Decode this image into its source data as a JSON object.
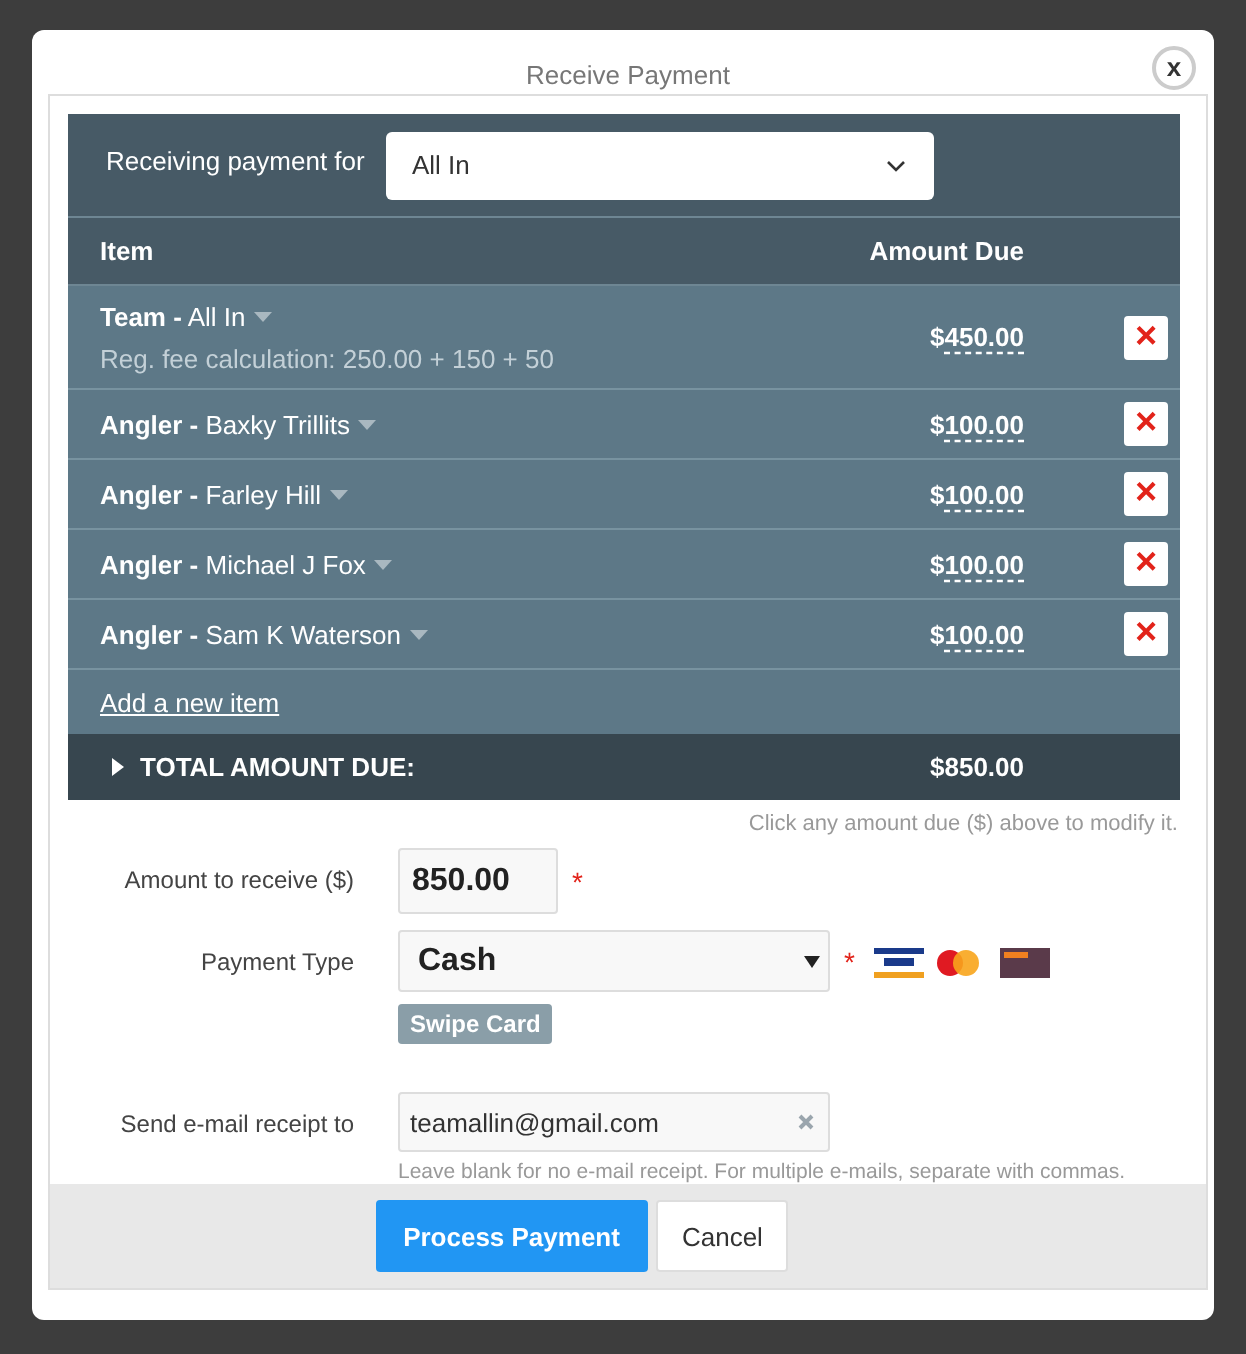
{
  "dialog": {
    "title": "Receive Payment",
    "close": "x"
  },
  "payer": {
    "label": "Receiving payment for",
    "value": "All In"
  },
  "table": {
    "columns": [
      "Item",
      "Amount Due"
    ],
    "rows": [
      {
        "category": "Team -",
        "name": "All In",
        "note": "Reg. fee calculation: 250.00 + 150 + 50",
        "currency": "$",
        "amount": "450.00",
        "remove": "×"
      },
      {
        "category": "Angler -",
        "name": "Baxky Trillits",
        "currency": "$",
        "amount": "100.00",
        "remove": "×"
      },
      {
        "category": "Angler -",
        "name": "Farley Hill",
        "currency": "$",
        "amount": "100.00",
        "remove": "×"
      },
      {
        "category": "Angler -",
        "name": "Michael J Fox",
        "currency": "$",
        "amount": "100.00",
        "remove": "×"
      },
      {
        "category": "Angler -",
        "name": "Sam K Waterson",
        "currency": "$",
        "amount": "100.00",
        "remove": "×"
      }
    ],
    "add_link": "Add a new item",
    "total": {
      "label": "TOTAL AMOUNT DUE:",
      "value": "$850.00",
      "expanded": false
    }
  },
  "hint": "Click any amount due ($) above to modify it.",
  "form": {
    "amount": {
      "label": "Amount to receive ($)",
      "value": "850.00",
      "required_mark": "*"
    },
    "payment_type": {
      "label": "Payment Type",
      "value": "Cash",
      "required_mark": "*",
      "swipe": "Swipe Card"
    },
    "email": {
      "label": "Send e-mail receipt to",
      "value": "teamallin@gmail.com",
      "help": "Leave blank for no e-mail receipt. For multiple e-mails, separate with commas."
    }
  },
  "buttons": [
    {
      "label": "Process Payment",
      "kind": "primary"
    },
    {
      "label": "Cancel",
      "kind": "secondary"
    }
  ]
}
